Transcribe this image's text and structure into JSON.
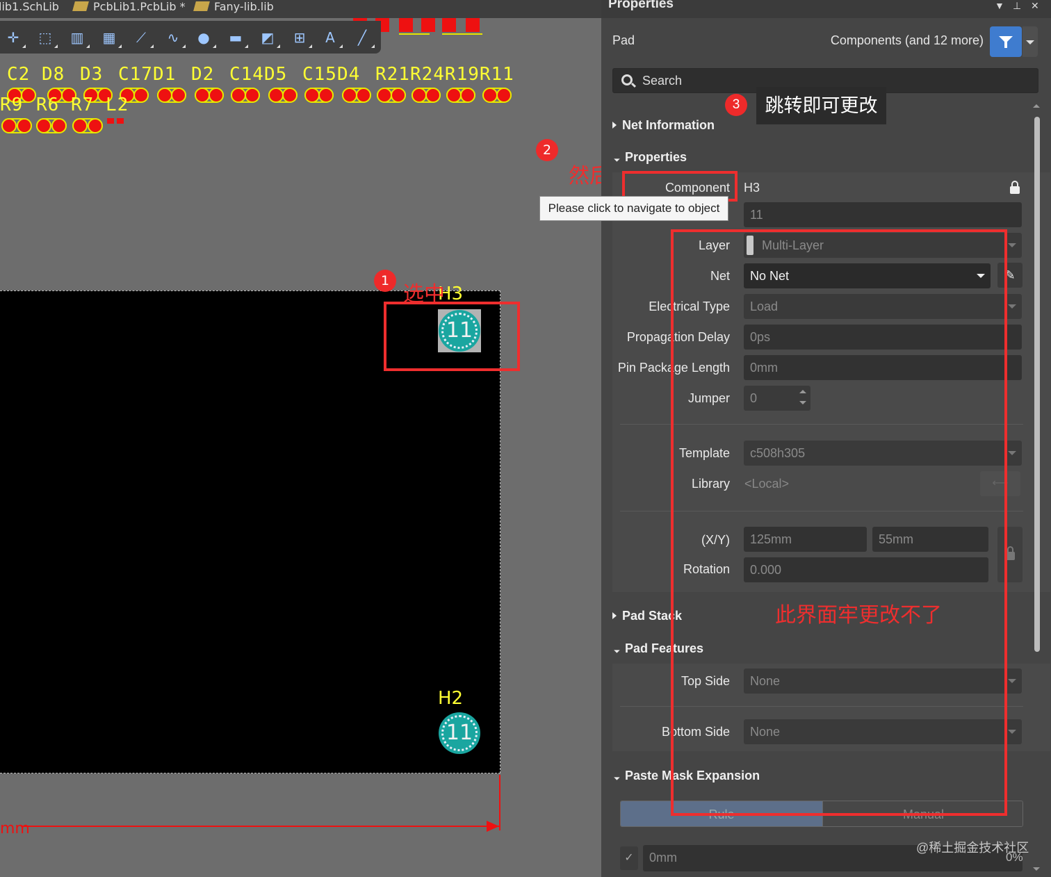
{
  "tabs": [
    "lib1.SchLib",
    "PcbLib1.PcbLib *",
    "Fany-lib.lib"
  ],
  "toolbar_icons": [
    "crosshair-icon",
    "select-rect-icon",
    "align-icon",
    "component-icon",
    "route-icon",
    "interactive-route-icon",
    "via-icon",
    "fill-icon",
    "region-icon",
    "dimension-icon",
    "text-icon",
    "line-icon"
  ],
  "designators_row1": [
    "C2",
    "D8",
    "D3",
    "C17D1",
    "D2",
    "C14D5",
    "C15D4",
    "R21R24R19R11"
  ],
  "designators_row2": [
    "R9",
    "R6",
    "R7",
    "L2"
  ],
  "canvas": {
    "h3_label": "H3",
    "h2_label": "H2",
    "h3_pad_number": "11",
    "h2_pad_number": "11",
    "unit_label": "mm"
  },
  "annotations": {
    "step1_num": "1",
    "step1_text": "选中",
    "step2_num": "2",
    "step2_text": "然后点击",
    "step3_num": "3",
    "step3_text": "跳转即可更改",
    "cannot_change": "此界面牢更改不了"
  },
  "panel": {
    "title": "Properties",
    "object_type": "Pad",
    "filter_text": "Components (and 12 more)",
    "search_placeholder": "Search",
    "sections": {
      "net_information": "Net Information",
      "properties": "Properties",
      "pad_stack": "Pad Stack",
      "pad_features": "Pad Features",
      "paste_mask": "Paste Mask Expansion"
    },
    "tooltip": "Please click to navigate to object",
    "fields": {
      "component_label": "Component",
      "component_value": "H3",
      "designator_value": "11",
      "layer_label": "Layer",
      "layer_value": "Multi-Layer",
      "net_label": "Net",
      "net_value": "No Net",
      "electrical_type_label": "Electrical Type",
      "electrical_type_value": "Load",
      "propagation_delay_label": "Propagation Delay",
      "propagation_delay_value": "0ps",
      "pin_package_length_label": "Pin Package Length",
      "pin_package_length_value": "0mm",
      "jumper_label": "Jumper",
      "jumper_value": "0",
      "template_label": "Template",
      "template_value": "c508h305",
      "library_label": "Library",
      "library_value": "<Local>",
      "xy_label": "(X/Y)",
      "x_value": "125mm",
      "y_value": "55mm",
      "rotation_label": "Rotation",
      "rotation_value": "0.000",
      "top_side_label": "Top Side",
      "top_side_value": "None",
      "bottom_side_label": "Bottom Side",
      "bottom_side_value": "None",
      "rule_label": "Rule",
      "manual_label": "Manual",
      "paste_value": "0mm",
      "paste_pct": "0%"
    },
    "watermark": "@稀土掘金技术社区"
  },
  "colors": {
    "designator": "#ffff33",
    "pad_red": "#ee1111",
    "annotation_red": "#ee2e2e",
    "hole_teal": "#1aa6a0",
    "accent_blue": "#3f7ccf"
  }
}
